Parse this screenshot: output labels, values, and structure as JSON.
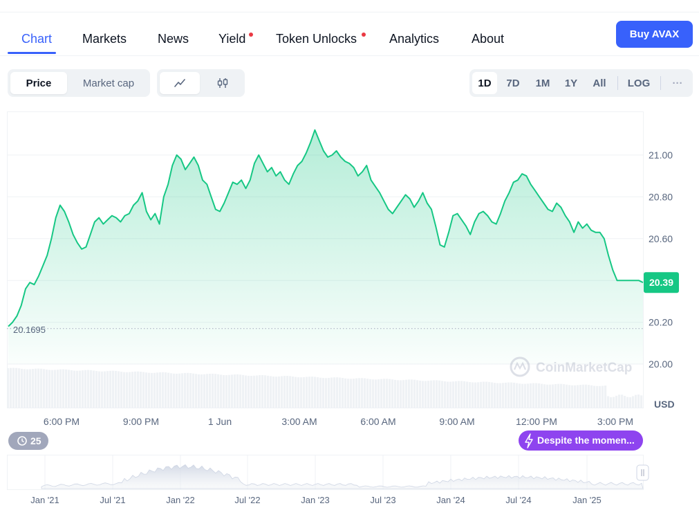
{
  "tabs": {
    "items": [
      {
        "label": "Chart",
        "active": true,
        "dot": false
      },
      {
        "label": "Markets",
        "active": false,
        "dot": false
      },
      {
        "label": "News",
        "active": false,
        "dot": false
      },
      {
        "label": "Yield",
        "active": false,
        "dot": true
      },
      {
        "label": "Token Unlocks",
        "active": false,
        "dot": true
      },
      {
        "label": "Analytics",
        "active": false,
        "dot": false
      },
      {
        "label": "About",
        "active": false,
        "dot": false
      }
    ],
    "buy_label": "Buy AVAX"
  },
  "toggles": {
    "price_label": "Price",
    "marketcap_label": "Market cap",
    "line_icon": "line-chart-icon",
    "candle_icon": "candlestick-icon"
  },
  "ranges": {
    "items": [
      "1D",
      "7D",
      "1M",
      "1Y",
      "All"
    ],
    "active": "1D",
    "log_label": "LOG",
    "more_label": "···"
  },
  "colors": {
    "accent": "#3861fb",
    "up_green": "#16c784",
    "badge_purple": "#8e44ef",
    "dot_red": "#ea3943",
    "history_badge": "#a1a7bb"
  },
  "chart_data": {
    "type": "area",
    "y_unit": "USD",
    "yticks": [
      20.0,
      20.2,
      20.4,
      20.6,
      20.8,
      21.0
    ],
    "ylim": [
      20.0,
      21.05
    ],
    "x_tick_labels": [
      "6:00 PM",
      "9:00 PM",
      "1 Jun",
      "3:00 AM",
      "6:00 AM",
      "9:00 AM",
      "12:00 PM",
      "3:00 PM"
    ],
    "open_price_label": "20.1695",
    "open_price": 20.1695,
    "current_price": 20.39,
    "current_price_label": "20.39",
    "watermark": "CoinMarketCap",
    "series": [
      {
        "values": [
          20.18,
          20.2,
          20.23,
          20.28,
          20.36,
          20.39,
          20.38,
          20.42,
          20.47,
          20.52,
          20.6,
          20.7,
          20.76,
          20.73,
          20.68,
          20.62,
          20.58,
          20.55,
          20.56,
          20.62,
          20.68,
          20.7,
          20.67,
          20.69,
          20.71,
          20.7,
          20.68,
          20.71,
          20.72,
          20.76,
          20.78,
          20.82,
          20.73,
          20.69,
          20.72,
          20.67,
          20.8,
          20.86,
          20.95,
          21.0,
          20.98,
          20.93,
          20.96,
          20.99,
          20.95,
          20.88,
          20.86,
          20.8,
          20.74,
          20.73,
          20.77,
          20.82,
          20.87,
          20.86,
          20.88,
          20.84,
          20.88,
          20.96,
          21.0,
          20.96,
          20.92,
          20.94,
          20.9,
          20.92,
          20.88,
          20.86,
          20.91,
          20.95,
          20.97,
          21.01,
          21.06,
          21.12,
          21.07,
          21.02,
          20.99,
          21.0,
          21.02,
          20.99,
          20.97,
          20.96,
          20.94,
          20.9,
          20.92,
          20.95,
          20.88,
          20.85,
          20.82,
          20.78,
          20.74,
          20.72,
          20.75,
          20.78,
          20.81,
          20.79,
          20.75,
          20.78,
          20.82,
          20.77,
          20.74,
          20.66,
          20.57,
          20.56,
          20.63,
          20.71,
          20.72,
          20.69,
          20.66,
          20.62,
          20.68,
          20.72,
          20.73,
          20.71,
          20.68,
          20.67,
          20.72,
          20.78,
          20.82,
          20.87,
          20.88,
          20.91,
          20.9,
          20.86,
          20.83,
          20.8,
          20.77,
          20.74,
          20.73,
          20.77,
          20.75,
          20.71,
          20.68,
          20.63,
          20.68,
          20.65,
          20.67,
          20.64,
          20.63,
          20.63,
          20.6,
          20.52,
          20.45,
          20.4,
          20.4,
          20.4,
          20.4,
          20.4,
          20.4,
          20.39
        ]
      }
    ],
    "volume": {
      "axis": "no-labels",
      "shape": "gradually-declining"
    },
    "navigator": {
      "x_tick_labels": [
        "Jan '21",
        "Jul '21",
        "Jan '22",
        "Jul '22",
        "Jan '23",
        "Jul '23",
        "Jan '24",
        "Jul '24",
        "Jan '25"
      ],
      "shape": "long-term-history"
    },
    "history_badge": {
      "count": "25",
      "icon": "history-icon"
    },
    "news_badge": {
      "label": "Despite the momen...",
      "icon": "lightning-icon"
    }
  }
}
